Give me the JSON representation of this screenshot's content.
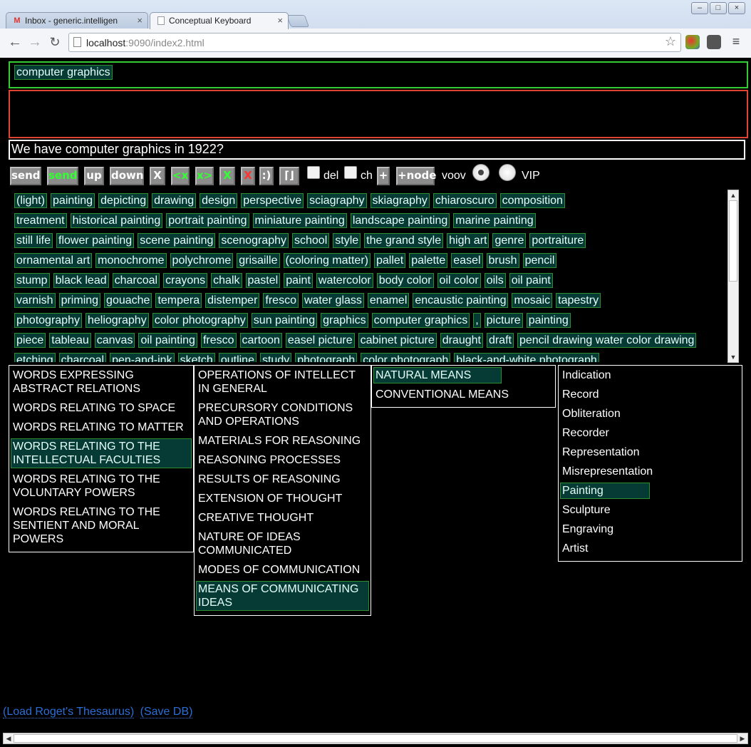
{
  "browser": {
    "tabs": [
      {
        "label": "Inbox - generic.intelligen",
        "icon": "gmail-icon",
        "active": false
      },
      {
        "label": "Conceptual Keyboard",
        "icon": "page-icon",
        "active": true
      }
    ],
    "url_host": "localhost",
    "url_rest": ":9090/index2.html"
  },
  "input": {
    "chip": "computer graphics"
  },
  "question": "We have computer graphics in 1922?",
  "buttons": {
    "send": "send",
    "send_green": "send",
    "up": "up",
    "down": "down",
    "x1": "X",
    "left": "<x",
    "right": "x>",
    "x_green": "X",
    "x_red": "X",
    "smile": ":)",
    "bracket": "⌈⌋",
    "del_label": "del",
    "ch_label": "ch",
    "plus": "+",
    "node": "+node",
    "voov_label": "voov",
    "vip_label": "VIP"
  },
  "words": [
    [
      "(light)",
      "painting",
      "depicting",
      "drawing",
      "design",
      "perspective",
      "sciagraphy",
      "skiagraphy",
      "chiaroscuro",
      "composition"
    ],
    [
      "treatment",
      "historical painting",
      "portrait painting",
      "miniature painting",
      "landscape painting",
      "marine painting"
    ],
    [
      "still life",
      "flower painting",
      "scene painting",
      "scenography",
      "school",
      "style",
      "the grand style",
      "high art",
      "genre",
      "portraiture"
    ],
    [
      "ornamental art",
      "monochrome",
      "polychrome",
      "grisaille",
      "(coloring matter)",
      "pallet",
      "palette",
      "easel",
      "brush",
      "pencil"
    ],
    [
      "stump",
      "black lead",
      "charcoal",
      "crayons",
      "chalk",
      "pastel",
      "paint",
      "watercolor",
      "body color",
      "oil color",
      "oils",
      "oil paint"
    ],
    [
      "varnish",
      "priming",
      "gouache",
      "tempera",
      "distemper",
      "fresco",
      "water glass",
      "enamel",
      "encaustic painting",
      "mosaic",
      "tapestry"
    ],
    [
      "photography",
      "heliography",
      "color photography",
      "sun painting",
      "graphics",
      "computer graphics",
      ",",
      "picture",
      "painting"
    ],
    [
      "piece",
      "tableau",
      "canvas",
      "oil painting",
      "fresco",
      "cartoon",
      "easel picture",
      "cabinet picture",
      "draught",
      "draft",
      "pencil drawing water color drawing"
    ],
    [
      "etching",
      "charcoal",
      "pen-and-ink",
      "sketch",
      "outline",
      "study",
      "photograph",
      "color photograph",
      "black-and-white photograph"
    ]
  ],
  "columns": {
    "col1": [
      {
        "label": "WORDS EXPRESSING ABSTRACT RELATIONS",
        "selected": false
      },
      {
        "label": "WORDS RELATING TO SPACE",
        "selected": false
      },
      {
        "label": "WORDS RELATING TO MATTER",
        "selected": false
      },
      {
        "label": "WORDS RELATING TO THE INTELLECTUAL FACULTIES",
        "selected": true
      },
      {
        "label": "WORDS RELATING TO THE VOLUNTARY POWERS",
        "selected": false
      },
      {
        "label": "WORDS RELATING TO THE SENTIENT AND MORAL POWERS",
        "selected": false
      }
    ],
    "col2": [
      {
        "label": "OPERATIONS OF INTELLECT IN GENERAL",
        "selected": false
      },
      {
        "label": "PRECURSORY CONDITIONS AND OPERATIONS",
        "selected": false
      },
      {
        "label": "MATERIALS FOR REASONING",
        "selected": false
      },
      {
        "label": "REASONING PROCESSES",
        "selected": false
      },
      {
        "label": "RESULTS OF REASONING",
        "selected": false
      },
      {
        "label": "EXTENSION OF THOUGHT",
        "selected": false
      },
      {
        "label": "CREATIVE THOUGHT",
        "selected": false
      },
      {
        "label": "NATURE OF IDEAS COMMUNICATED",
        "selected": false
      },
      {
        "label": "MODES OF COMMUNICATION",
        "selected": false
      },
      {
        "label": "MEANS OF COMMUNICATING IDEAS",
        "selected": true
      }
    ],
    "col3": [
      {
        "label": "NATURAL MEANS",
        "selected": true
      },
      {
        "label": "CONVENTIONAL MEANS",
        "selected": false
      }
    ],
    "col4": [
      {
        "label": "Indication",
        "selected": false
      },
      {
        "label": "Record",
        "selected": false
      },
      {
        "label": "Obliteration",
        "selected": false
      },
      {
        "label": "Recorder",
        "selected": false
      },
      {
        "label": "Representation",
        "selected": false
      },
      {
        "label": "Misrepresentation",
        "selected": false
      },
      {
        "label": "Painting",
        "selected": true
      },
      {
        "label": "Sculpture",
        "selected": false
      },
      {
        "label": "Engraving",
        "selected": false
      },
      {
        "label": "Artist",
        "selected": false
      }
    ]
  },
  "links": {
    "load": "(Load Roget's Thesaurus)",
    "save": "(Save DB)"
  }
}
